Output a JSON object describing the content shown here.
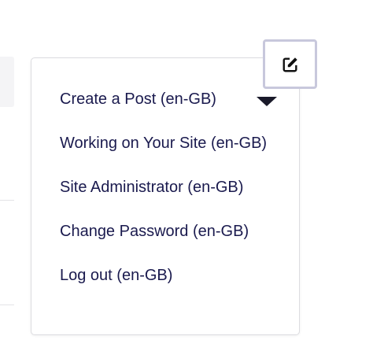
{
  "dropdown": {
    "items": [
      {
        "label": "Create a Post (en-GB)"
      },
      {
        "label": "Working on Your Site (en-GB)"
      },
      {
        "label": "Site Administrator (en-GB)"
      },
      {
        "label": "Change Password (en-GB)"
      },
      {
        "label": "Log out (en-GB)"
      }
    ]
  },
  "icons": {
    "edit": "edit-icon",
    "caret": "caret-down-icon"
  },
  "colors": {
    "menu_text": "#1a1a4e",
    "edit_border": "#c8c8dc",
    "panel_border": "#dcdce0"
  }
}
